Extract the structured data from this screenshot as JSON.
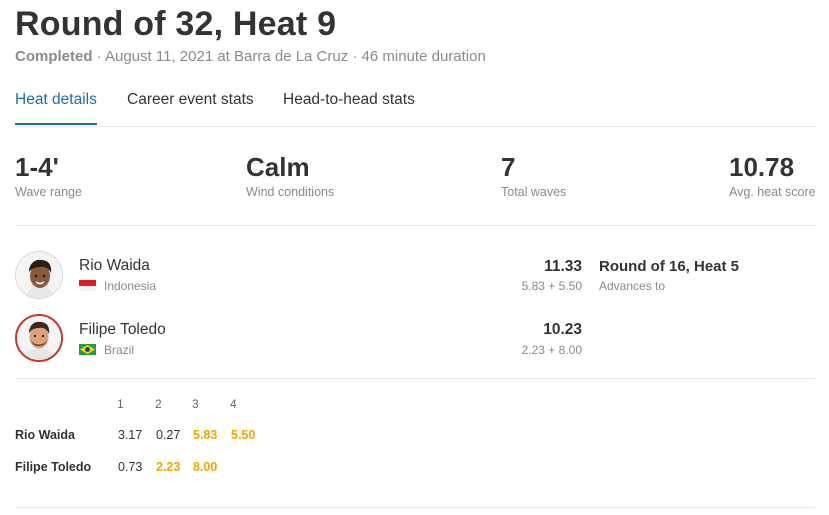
{
  "header": {
    "title": "Round of 32, Heat 9",
    "status": "Completed",
    "meta": " · August 11, 2021 at Barra de La Cruz · 46 minute duration"
  },
  "tabs": [
    {
      "label": "Heat details",
      "active": true
    },
    {
      "label": "Career event stats",
      "active": false
    },
    {
      "label": "Head-to-head stats",
      "active": false
    }
  ],
  "stats": [
    {
      "value": "1-4'",
      "label": "Wave range"
    },
    {
      "value": "Calm",
      "label": "Wind conditions"
    },
    {
      "value": "7",
      "label": "Total waves"
    },
    {
      "value": "10.78",
      "label": "Avg. heat score"
    }
  ],
  "surfers": [
    {
      "name": "Rio Waida",
      "country": "Indonesia",
      "total": "11.33",
      "breakdown": "5.83 + 5.50"
    },
    {
      "name": "Filipe Toledo",
      "country": "Brazil",
      "total": "10.23",
      "breakdown": "2.23 + 8.00"
    }
  ],
  "advance": {
    "title": "Round of 16, Heat 5",
    "label": "Advances to"
  },
  "wave_table": {
    "headers": [
      "1",
      "2",
      "3",
      "4"
    ],
    "rows": [
      {
        "name": "Rio Waida",
        "scores": [
          "3.17",
          "0.27",
          "5.83",
          "5.50"
        ],
        "counting": [
          false,
          false,
          true,
          true
        ]
      },
      {
        "name": "Filipe Toledo",
        "scores": [
          "0.73",
          "2.23",
          "8.00"
        ],
        "counting": [
          false,
          true,
          true
        ]
      }
    ]
  },
  "colors": {
    "accent": "#1a6fb0",
    "counting_score": "#f0a500",
    "loser_ring": "#c0392b"
  }
}
